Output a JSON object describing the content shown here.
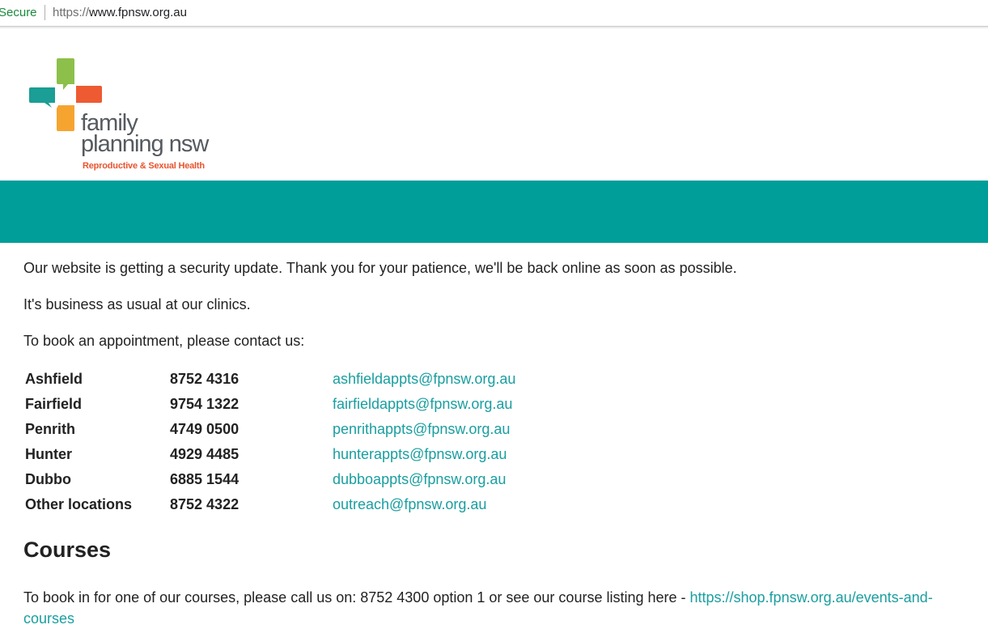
{
  "browser": {
    "secure_label": "Secure",
    "url_scheme": "https://",
    "url_host": "www.fpnsw.org.au"
  },
  "logo": {
    "line1": "family",
    "line2": "planning nsw",
    "tagline": "Reproductive & Sexual Health",
    "colors": {
      "green": "#8cc04a",
      "orange": "#ee5a32",
      "teal": "#1a9e95",
      "yellow": "#f6a430"
    }
  },
  "banner": {
    "color": "#009e99"
  },
  "notice": {
    "line1": "Our website is getting a security update. Thank you for your patience, we'll be back online as soon as possible.",
    "line2": "It's business as usual at our clinics.",
    "line3": "To book an appointment, please contact us:"
  },
  "clinics": [
    {
      "name": "Ashfield",
      "phone": "8752 4316",
      "email": "ashfieldappts@fpnsw.org.au"
    },
    {
      "name": "Fairfield",
      "phone": "9754 1322",
      "email": "fairfieldappts@fpnsw.org.au"
    },
    {
      "name": "Penrith",
      "phone": "4749 0500",
      "email": "penrithappts@fpnsw.org.au"
    },
    {
      "name": "Hunter",
      "phone": "4929 4485",
      "email": "hunterappts@fpnsw.org.au"
    },
    {
      "name": "Dubbo",
      "phone": "6885 1544",
      "email": "dubboappts@fpnsw.org.au"
    },
    {
      "name": "Other locations",
      "phone": "8752 4322",
      "email": "outreach@fpnsw.org.au"
    }
  ],
  "courses": {
    "heading": "Courses",
    "text": "To book in for one of our courses, please call us on: 8752 4300 option 1 or see our course listing here - ",
    "link_part1": "https://shop.fpnsw.org.au/events-and-",
    "link_part2": "courses"
  },
  "link_color": "#1a9ea0"
}
